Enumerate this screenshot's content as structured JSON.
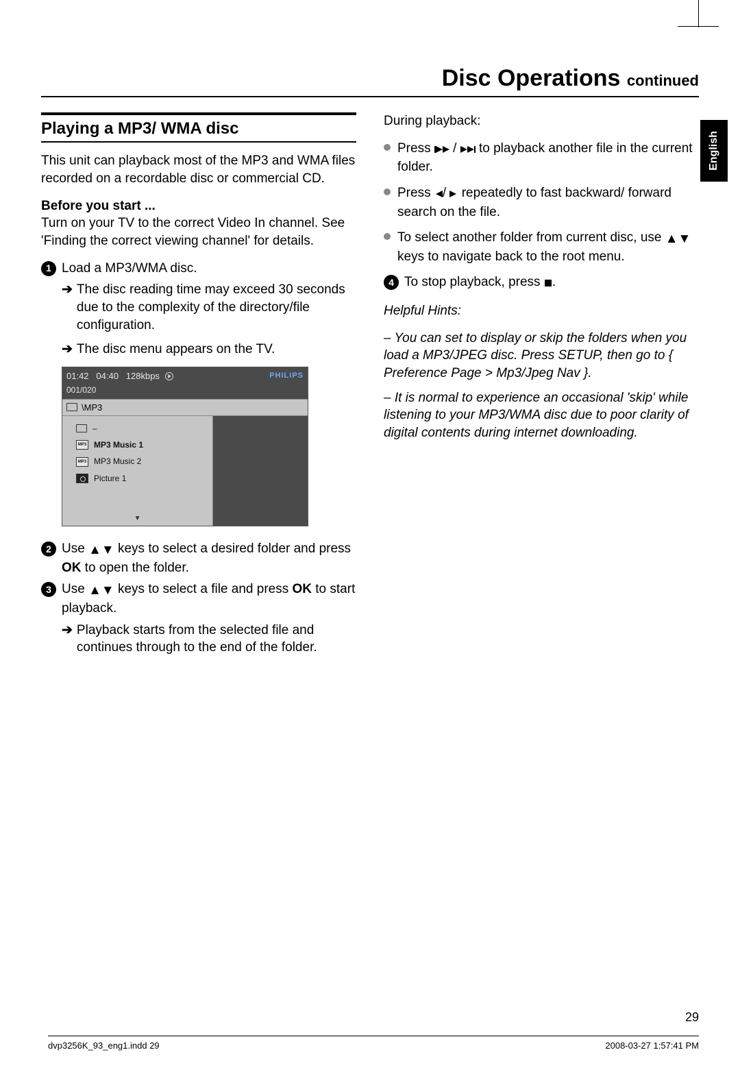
{
  "header": {
    "title": "Disc Operations",
    "continued": "continued"
  },
  "lang_tab": "English",
  "section_title": "Playing a MP3/ WMA disc",
  "intro": "This unit can playback most of the MP3 and WMA files recorded on a recordable disc or commercial CD.",
  "before_label": "Before you start ...",
  "before_text": "Turn on your TV to the correct Video In channel. See 'Finding the correct viewing channel' for details.",
  "step1": "Load a MP3/WMA disc.",
  "step1_note1": "The disc reading time may exceed 30 seconds due to the complexity of the directory/file configuration.",
  "step1_note2": "The disc menu appears on the TV.",
  "screen": {
    "time_elapsed": "01:42",
    "time_total": "04:40",
    "bitrate": "128kbps",
    "brand": "PHILIPS",
    "track": "001/020",
    "path": "\\MP3",
    "items": [
      {
        "type": "up",
        "label": "–"
      },
      {
        "type": "mp3",
        "label": "MP3 Music 1"
      },
      {
        "type": "mp3",
        "label": "MP3 Music 2"
      },
      {
        "type": "pic",
        "label": "Picture 1"
      }
    ]
  },
  "step2_a": "Use ",
  "step2_b": " keys to select a desired folder and press ",
  "step2_ok": "OK",
  "step2_c": " to open the folder.",
  "step3_a": "Use ",
  "step3_b": " keys to select a file and press ",
  "step3_ok": "OK",
  "step3_c": " to start playback.",
  "step3_note": "Playback starts from the selected file and continues through to the end of the folder.",
  "r_during": "During playback:",
  "r_b1_a": "Press  ",
  "r_b1_b": "  to playback another file in the current folder.",
  "r_b2_a": "Press ",
  "r_b2_b": " repeatedly to fast backward/ forward search on the file.",
  "r_b3_a": "To select another folder from current disc, use ",
  "r_b3_b": " keys to navigate back to the root menu.",
  "step4_a": "To stop playback, press ",
  "step4_b": ".",
  "hints_label": "Helpful Hints:",
  "hint1": "–  You can set to display or skip the folders when you load a MP3/JPEG disc. Press SETUP, then go to { Preference Page > Mp3/Jpeg Nav }.",
  "hint2": "–  It is normal to experience an occasional 'skip' while listening to your MP3/WMA disc due to poor clarity of digital contents during internet downloading.",
  "page_number": "29",
  "footer_left": "dvp3256K_93_eng1.indd   29",
  "footer_right": "2008-03-27   1:57:41 PM"
}
